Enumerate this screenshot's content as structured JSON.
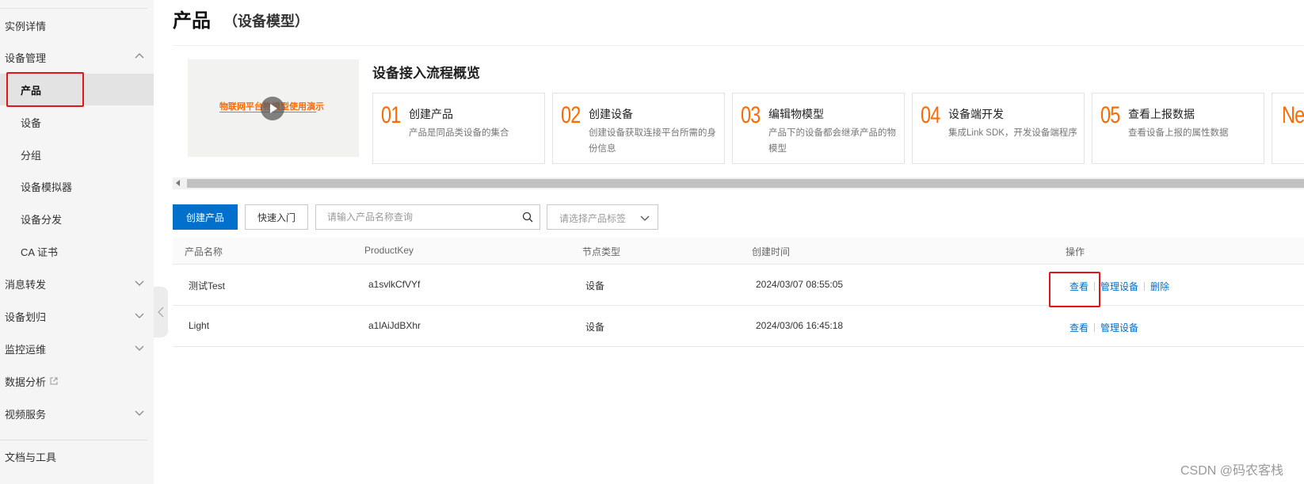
{
  "sidebar": {
    "items": [
      {
        "label": "实例详情"
      },
      {
        "label": "设备管理"
      },
      {
        "label": "产品"
      },
      {
        "label": "设备"
      },
      {
        "label": "分组"
      },
      {
        "label": "设备模拟器"
      },
      {
        "label": "设备分发"
      },
      {
        "label": "CA 证书"
      },
      {
        "label": "消息转发"
      },
      {
        "label": "设备划归"
      },
      {
        "label": "监控运维"
      },
      {
        "label": "数据分析"
      },
      {
        "label": "视频服务"
      },
      {
        "label": "文档与工具"
      }
    ]
  },
  "header": {
    "title": "产品",
    "subtitle": "（设备模型）"
  },
  "overview": {
    "video_caption": "物联网平台物模型使用演示",
    "title": "设备接入流程概览",
    "steps": [
      {
        "num": "01",
        "title": "创建产品",
        "desc": "产品是同品类设备的集合"
      },
      {
        "num": "02",
        "title": "创建设备",
        "desc": "创建设备获取连接平台所需的身份信息"
      },
      {
        "num": "03",
        "title": "编辑物模型",
        "desc": "产品下的设备都会继承产品的物模型"
      },
      {
        "num": "04",
        "title": "设备端开发",
        "desc": "集成Link SDK，开发设备端程序"
      },
      {
        "num": "05",
        "title": "查看上报数据",
        "desc": "查看设备上报的属性数据"
      }
    ],
    "next_partial": "Ne"
  },
  "toolbar": {
    "create_label": "创建产品",
    "quick_label": "快速入门",
    "search_placeholder": "请输入产品名称查询",
    "tag_placeholder": "请选择产品标签"
  },
  "table": {
    "headers": [
      "产品名称",
      "ProductKey",
      "节点类型",
      "创建时间",
      "操作"
    ],
    "rows": [
      {
        "name": "测试Test",
        "key": "a1svlkCfVYf",
        "node": "设备",
        "created": "2024/03/07 08:55:05",
        "ops": [
          "查看",
          "管理设备",
          "删除"
        ]
      },
      {
        "name": "Light",
        "key": "a1lAiJdBXhr",
        "node": "设备",
        "created": "2024/03/06 16:45:18",
        "ops": [
          "查看",
          "管理设备"
        ]
      }
    ]
  },
  "watermark": "CSDN @码农客栈",
  "colors": {
    "accent": "#0070cc",
    "highlight": "#e4141b",
    "step_number": "#ff6a00"
  }
}
